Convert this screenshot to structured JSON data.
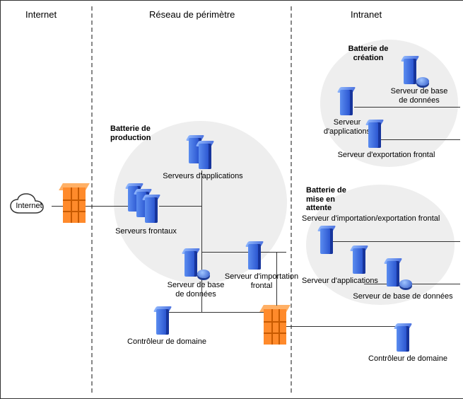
{
  "zones": {
    "internet": "Internet",
    "perimeter": "Réseau de périmètre",
    "intranet": "Intranet"
  },
  "cloud": {
    "label": "Internet"
  },
  "clusters": {
    "production": "Batterie de\nproduction",
    "creation": "Batterie de\ncréation",
    "staging": "Batterie de\nmise en\nattente"
  },
  "nodes": {
    "front_servers": "Serveurs frontaux",
    "app_servers": "Serveurs d'applications",
    "db_server": "Serveur de base\nde données",
    "import_front": "Serveur d'importation\nfrontal",
    "domain_ctrl_left": "Contrôleur de domaine",
    "creation_db": "Serveur de base\nde données",
    "creation_app": "Serveur\nd'applications",
    "export_front": "Serveur d'exportation frontal",
    "staging_impexp": "Serveur d'importation/exportation frontal",
    "staging_app": "Serveur d'applications",
    "staging_db": "Serveur de base de données",
    "domain_ctrl_right": "Contrôleur de domaine"
  }
}
